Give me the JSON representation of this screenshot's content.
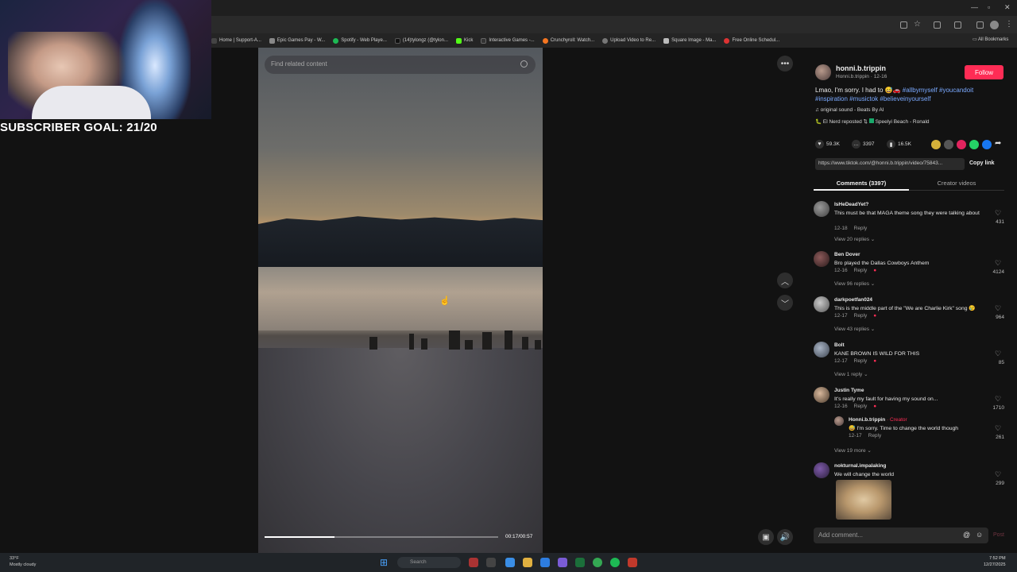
{
  "bookmarks": [
    "Home | Support-A...",
    "Epic Games Pay - W...",
    "Spotify - Web Playe...",
    "(14)tylongz (@tylon...",
    "Kick",
    "Interactive Games -...",
    "Crunchyroll: Watch...",
    "Upload Video to Re...",
    "Square Image - Ma...",
    "Free Online Schedul..."
  ],
  "all_bookmarks": "All Bookmarks",
  "overlay": {
    "subscriber_goal": "SUBSCRIBER GOAL: 21/20"
  },
  "video": {
    "search_placeholder": "Find related content",
    "time": "00:17/00:57",
    "progress": 0.3
  },
  "post": {
    "author": "honni.b.trippin",
    "author_sub": "Honni.b.trippin · 12-16",
    "follow": "Follow",
    "caption_text": "Lmao, I'm sorry. I had to 😅🚗",
    "caption_tags_1": " #allbymyself #youcandoit",
    "caption_tags_2": "#inspiration #musictok #believeinyourself",
    "sound": "♫  original sound - Beats By AI",
    "repost_user": "El Nerd",
    "repost_text": "reposted",
    "repost_track": "Speelyi Beach - Ronald",
    "likes": "59.3K",
    "comments_count": "3397",
    "saves": "16.5K",
    "link": "https://www.tiktok.com/@honni.b.trippin/video/75843...",
    "copy_link": "Copy link",
    "tab_comments": "Comments (3397)",
    "tab_creator": "Creator videos"
  },
  "comments": [
    {
      "name": "IsHeDeadYet?",
      "text": "This must be that MAGA theme song they were talking about",
      "date": "12-18",
      "reply": "Reply",
      "likes": "431",
      "more": "View 20 replies ⌄"
    },
    {
      "name": "Ben Dover",
      "text": "Bro played the Dallas Cowboys Anthem",
      "date": "12-16",
      "reply": "Reply",
      "likes": "4124",
      "more": "View 96 replies ⌄"
    },
    {
      "name": "darkpoetfan024",
      "text": "This is the middle part of the \"We are Charlie Kirk\" song 😢",
      "date": "12-17",
      "reply": "Reply",
      "likes": "964",
      "more": "View 43 replies ⌄"
    },
    {
      "name": "Bolt",
      "text": "KANE BROWN IS WILD FOR THIS",
      "date": "12-17",
      "reply": "Reply",
      "likes": "85",
      "more": "View 1 reply ⌄"
    },
    {
      "name": "Justin Tyme",
      "text": "It's really my fault for having my sound on...",
      "date": "12-16",
      "reply": "Reply",
      "likes": "1710",
      "more": "View 19 more ⌄"
    },
    {
      "name": "nokturnal.impalaking",
      "text": "We will change the world",
      "likes": "299"
    }
  ],
  "creator_reply": {
    "name": "Honni.b.trippin",
    "tag": " · Creator",
    "text": "😅 I'm sorry. Time to change the world though",
    "date": "12-17",
    "reply": "Reply",
    "likes": "261"
  },
  "add_comment": "Add comment...",
  "post_btn": "Post",
  "taskbar": {
    "temp": "33°F",
    "weather": "Mostly cloudy",
    "search": "Search",
    "time": "7:52 PM",
    "date": "12/27/2025"
  },
  "colors": {
    "accent": "#fe2c55",
    "hashtag": "#7aa9ff"
  }
}
